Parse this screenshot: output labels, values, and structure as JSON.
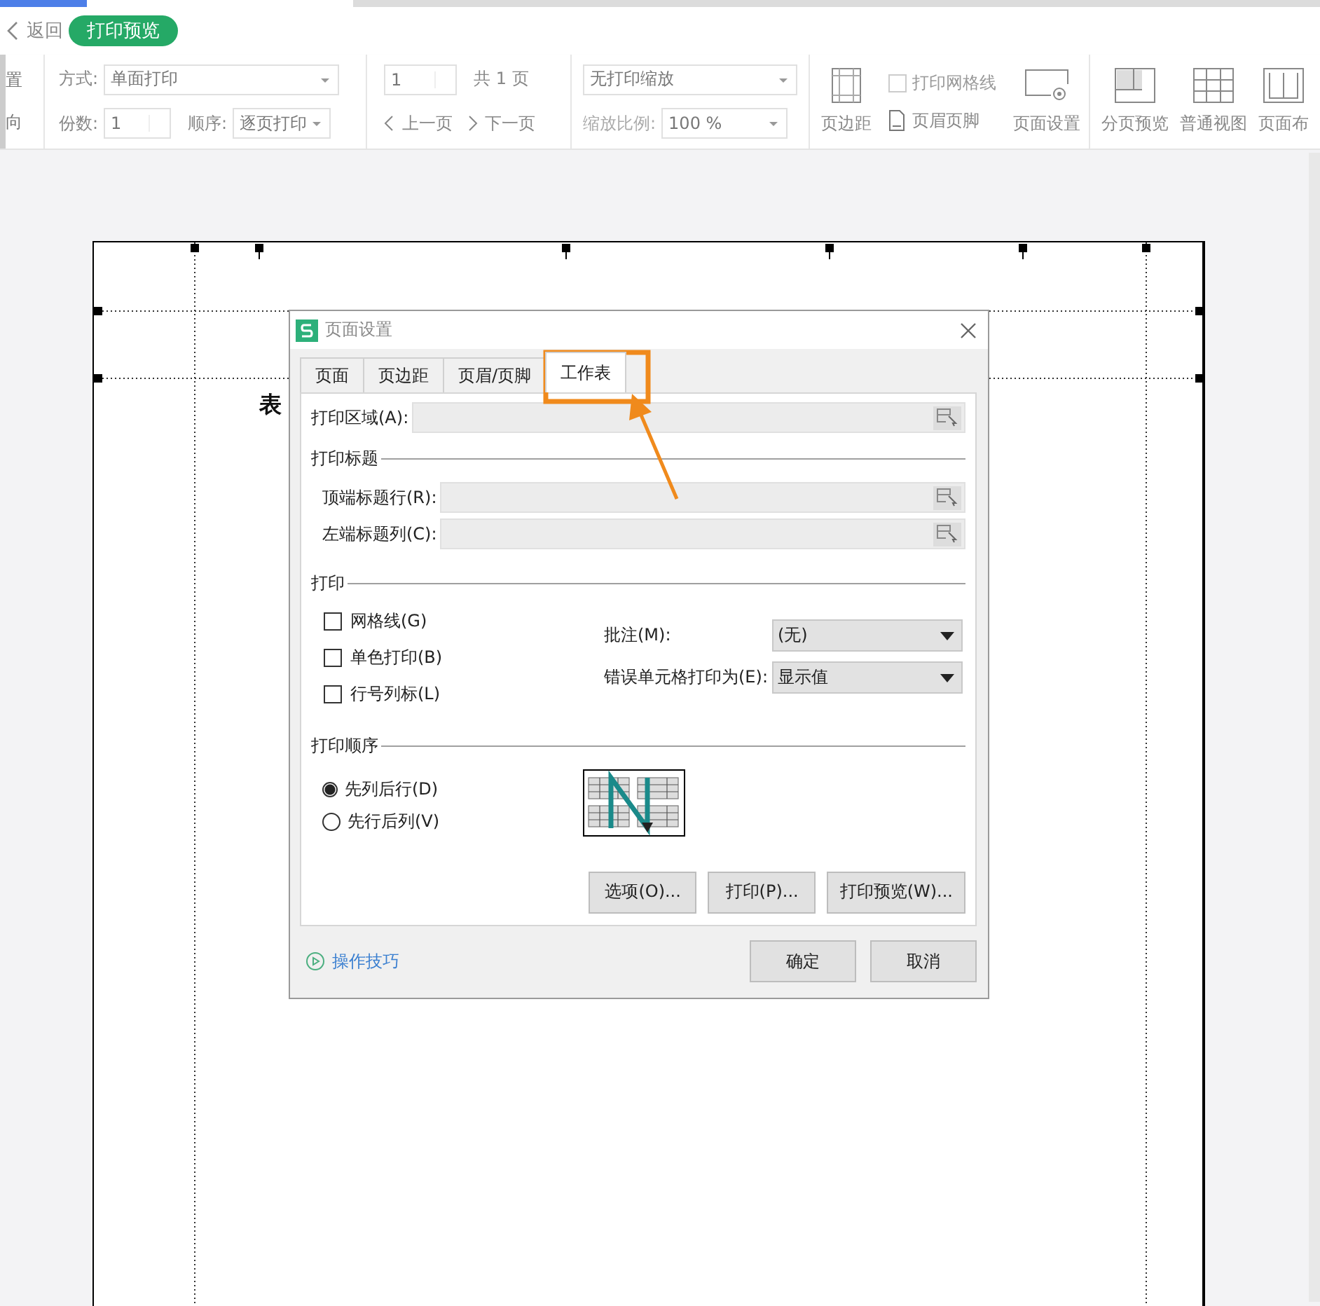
{
  "header": {
    "back": "返回",
    "mode": "打印预览"
  },
  "toolbar": {
    "cut_labels": [
      "置",
      "向"
    ],
    "print_mode": {
      "label": "方式:",
      "value": "单面打印"
    },
    "copies": {
      "label": "份数:",
      "value": "1"
    },
    "order": {
      "label": "顺序:",
      "value": "逐页打印"
    },
    "page": {
      "value": "1",
      "total": "共 1 页",
      "prev": "上一页",
      "next": "下一页"
    },
    "scaling": {
      "value": "无打印缩放",
      "ratio_label": "缩放比例:",
      "ratio_value": "100 %"
    },
    "margins": {
      "label": "页边距"
    },
    "gridlines": {
      "label": "打印网格线",
      "checked": false
    },
    "header_footer": {
      "label": "页眉页脚"
    },
    "page_setup": {
      "label": "页面设置"
    },
    "views": [
      {
        "label": "分页预览"
      },
      {
        "label": "普通视图"
      },
      {
        "label": "页面布"
      }
    ]
  },
  "sheet": {
    "text": "表"
  },
  "dialog": {
    "title": "页面设置",
    "tabs": [
      {
        "label": "页面",
        "selected": false
      },
      {
        "label": "页边距",
        "selected": false
      },
      {
        "label": "页眉/页脚",
        "selected": false
      },
      {
        "label": "工作表",
        "selected": true
      }
    ],
    "print_area": {
      "label": "打印区域(A):"
    },
    "titles": {
      "heading": "打印标题",
      "rows": [
        {
          "label": "顶端标题行(R):"
        },
        {
          "label": "左端标题列(C):"
        }
      ]
    },
    "print": {
      "heading": "打印",
      "options": [
        {
          "label": "网格线(G)",
          "checked": false
        },
        {
          "label": "单色打印(B)",
          "checked": false
        },
        {
          "label": "行号列标(L)",
          "checked": false
        }
      ],
      "selects": [
        {
          "label": "批注(M):",
          "value": "(无)"
        },
        {
          "label": "错误单元格打印为(E):",
          "value": "显示值"
        }
      ]
    },
    "order": {
      "heading": "打印顺序",
      "options": [
        {
          "label": "先列后行(D)",
          "selected": true
        },
        {
          "label": "先行后列(V)",
          "selected": false
        }
      ]
    },
    "buttons": [
      "选项(O)...",
      "打印(P)...",
      "打印预览(W)..."
    ],
    "help": "操作技巧",
    "footer_buttons": [
      "确定",
      "取消"
    ]
  }
}
